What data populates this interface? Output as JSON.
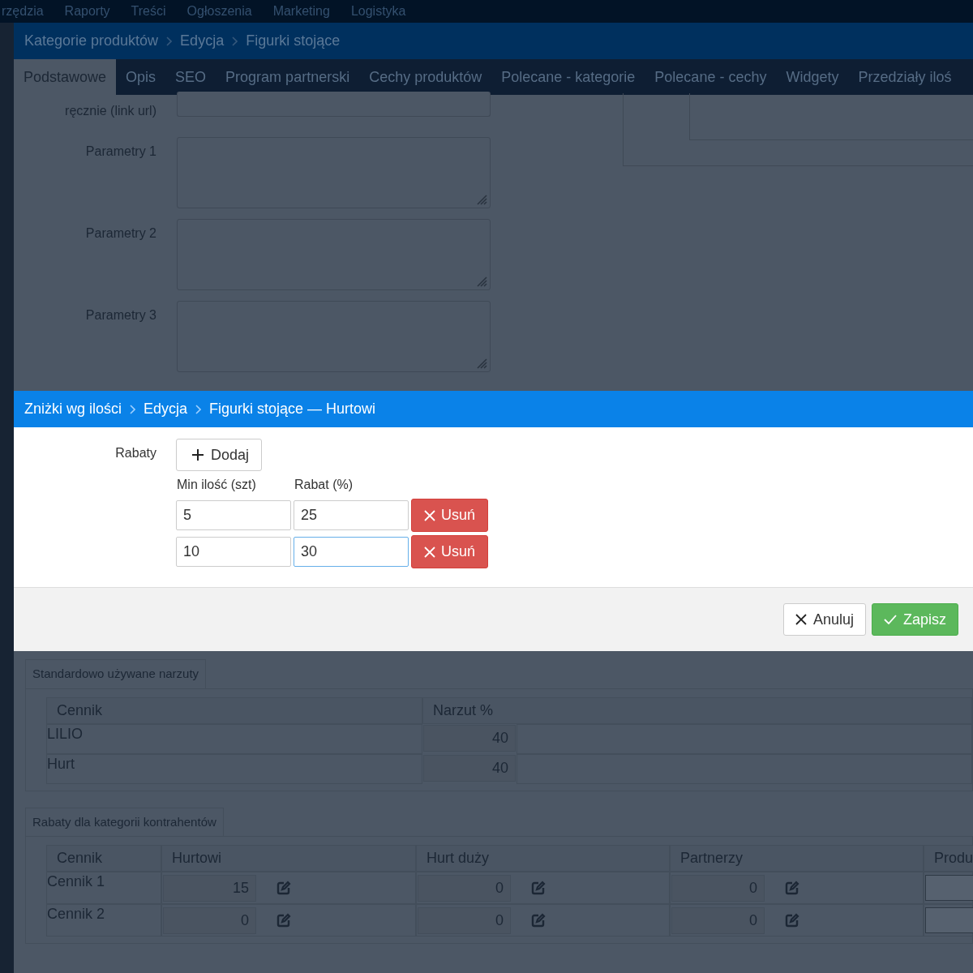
{
  "top_nav": {
    "items": [
      "rzędzia",
      "Raporty",
      "Treści",
      "Ogłoszenia",
      "Marketing",
      "Logistyka"
    ]
  },
  "back_dialog": {
    "breadcrumb": [
      "Kategorie produktów",
      "Edycja",
      "Figurki stojące"
    ],
    "tabs": [
      {
        "label": "Podstawowe",
        "selected": true
      },
      {
        "label": "Opis",
        "selected": false
      },
      {
        "label": "SEO",
        "selected": false
      },
      {
        "label": "Program partnerski",
        "selected": false
      },
      {
        "label": "Cechy produktów",
        "selected": false
      },
      {
        "label": "Polecane - kategorie",
        "selected": false
      },
      {
        "label": "Polecane - cechy",
        "selected": false
      },
      {
        "label": "Widgety",
        "selected": false
      },
      {
        "label": "Przedziały iloś",
        "selected": false
      }
    ],
    "fields": [
      {
        "label": "ręcznie (link url)",
        "kind": "input"
      },
      {
        "label": "Parametry 1",
        "kind": "textarea"
      },
      {
        "label": "Parametry 2",
        "kind": "textarea"
      },
      {
        "label": "Parametry 3",
        "kind": "textarea"
      }
    ],
    "markups": {
      "legend": "Standardowo używane narzuty",
      "columns": [
        "Cennik",
        "Narzut %"
      ],
      "rows": [
        {
          "name": "LILIO",
          "value": "40"
        },
        {
          "name": "Hurt",
          "value": "40"
        }
      ]
    },
    "discounts": {
      "legend": "Rabaty dla kategorii kontrahentów",
      "columns": [
        "Cennik",
        "Hurtowi",
        "Hurt duży",
        "Partnerzy",
        "Produ"
      ],
      "rows": [
        {
          "name": "Cennik 1",
          "values": [
            "15",
            "0",
            "0"
          ]
        },
        {
          "name": "Cennik 2",
          "values": [
            "0",
            "0",
            "0"
          ]
        }
      ]
    }
  },
  "dialog": {
    "breadcrumb": [
      "Zniżki wg ilości",
      "Edycja",
      "Figurki stojące — Hurtowi"
    ],
    "label": "Rabaty",
    "add_button": "Dodaj",
    "columns": [
      "Min ilość (szt)",
      "Rabat (%)"
    ],
    "rows": [
      {
        "min": "5",
        "discount": "25",
        "focused": false,
        "remove": "Usuń"
      },
      {
        "min": "10",
        "discount": "30",
        "focused": true,
        "remove": "Usuń"
      }
    ],
    "buttons": [
      {
        "label": "Anuluj",
        "kind": "cancel"
      },
      {
        "label": "Zapisz",
        "kind": "save"
      }
    ]
  }
}
